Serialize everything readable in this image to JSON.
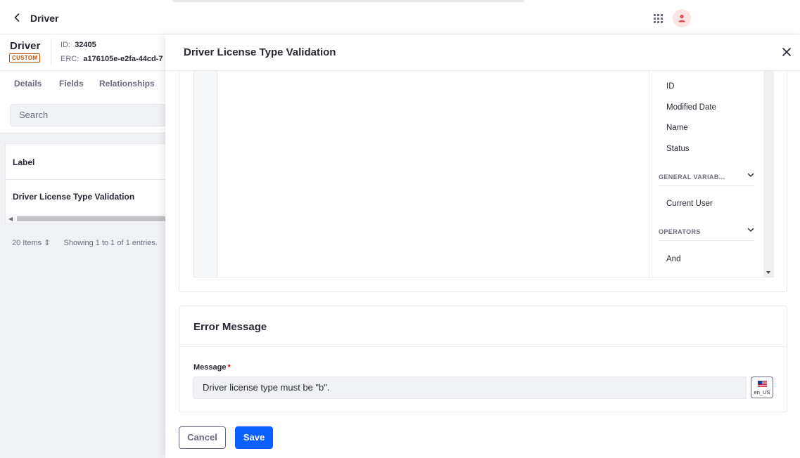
{
  "topbar": {
    "title": "Driver"
  },
  "object": {
    "name": "Driver",
    "badge": "CUSTOM",
    "id_label": "ID:",
    "id_value": "32405",
    "erc_label": "ERC:",
    "erc_value": "a176105e-e2fa-44cd-7"
  },
  "left_tabs": [
    "Details",
    "Fields",
    "Relationships"
  ],
  "left_search": {
    "placeholder": "Search"
  },
  "left_table": {
    "header": "Label",
    "row": "Driver License Type Validation"
  },
  "left_footer": {
    "items": "20 Items",
    "entries": "Showing 1 to 1 of 1 entries."
  },
  "panel": {
    "title": "Driver License Type Validation"
  },
  "sidebar": {
    "fields": [
      "ID",
      "Modified Date",
      "Name",
      "Status"
    ],
    "general_variables_label": "GENERAL VARIAB...",
    "general_variables": [
      "Current User"
    ],
    "operators_label": "OPERATORS",
    "operators": [
      "And"
    ]
  },
  "error_message": {
    "title": "Error Message",
    "label": "Message",
    "required_mark": "*",
    "value": "Driver license type must be \"b\".",
    "locale": "en_US"
  },
  "actions": {
    "cancel": "Cancel",
    "save": "Save"
  },
  "colors": {
    "primary": "#0b5fff",
    "badge": "#b95000",
    "required": "#da1414",
    "avatar_bg": "#fbe4e4"
  }
}
